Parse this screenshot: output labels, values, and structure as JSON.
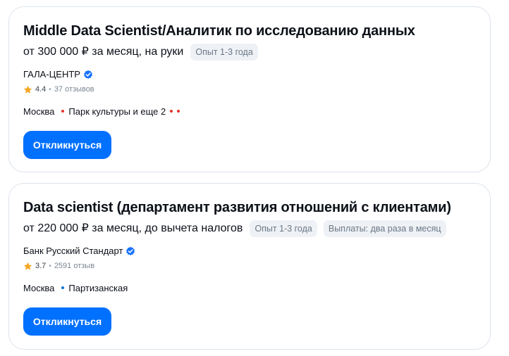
{
  "colors": {
    "accent": "#0070ff",
    "verified": "#1a73ff",
    "star": "#f5a623",
    "metro_red": "#e8302b",
    "metro_blue": "#0a74d6"
  },
  "vacancies": [
    {
      "title": "Middle Data Scientist/Аналитик по исследованию данных",
      "salary": "от 300 000 ₽ за месяц, на руки",
      "chips": [
        "Опыт 1-3 года"
      ],
      "company": "ГАЛА-ЦЕНТР",
      "company_icon": "verified-icon",
      "rating": "4.4",
      "reviews": "37 отзывов",
      "city": "Москва",
      "metro": "Парк культуры и еще 2",
      "apply_label": "Откликнуться"
    },
    {
      "title": "Data scientist (департамент развития отношений с клиентами)",
      "salary": "от 220 000 ₽ за месяц, до вычета налогов",
      "chips": [
        "Опыт 1-3 года",
        "Выплаты: два раза в месяц"
      ],
      "company": "Банк Русский Стандарт",
      "company_icon": "verified-icon",
      "rating": "3.7",
      "reviews": "2591 отзыв",
      "city": "Москва",
      "metro": "Партизанская",
      "apply_label": "Откликнуться"
    }
  ]
}
